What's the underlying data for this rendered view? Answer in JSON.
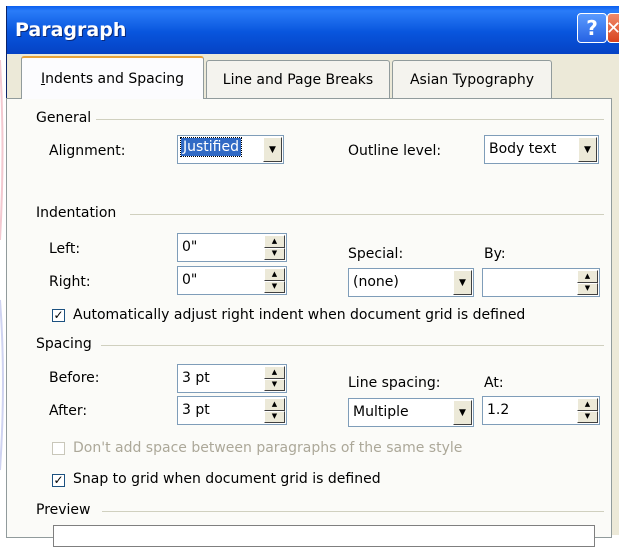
{
  "dialog": {
    "title": "Paragraph",
    "help_glyph": "?",
    "close_glyph": "✕"
  },
  "tabs": [
    {
      "label": "Indents and Spacing",
      "active": true
    },
    {
      "label": "Line and Page Breaks",
      "active": false
    },
    {
      "label": "Asian Typography",
      "active": false
    }
  ],
  "general": {
    "label": "General",
    "alignment_label": "Alignment:",
    "alignment_value": "Justified",
    "outline_label": "Outline level:",
    "outline_value": "Body text"
  },
  "indentation": {
    "label": "Indentation",
    "left_label": "Left:",
    "left_value": "0\"",
    "right_label": "Right:",
    "right_value": "0\"",
    "special_label": "Special:",
    "special_value": "(none)",
    "by_label": "By:",
    "by_value": "",
    "auto_adjust_label": "Automatically adjust right indent when document grid is defined",
    "auto_adjust_checked": true
  },
  "spacing": {
    "label": "Spacing",
    "before_label": "Before:",
    "before_value": "3 pt",
    "after_label": "After:",
    "after_value": "3 pt",
    "line_spacing_label": "Line spacing:",
    "line_spacing_value": "Multiple",
    "at_label": "At:",
    "at_value": "1.2",
    "dont_add_label": "Don't add space between paragraphs of the same style",
    "dont_add_checked": false,
    "snap_label": "Snap to grid when document grid is defined",
    "snap_checked": true
  },
  "preview": {
    "label": "Preview"
  },
  "colors": {
    "title_bar": "#0855dd",
    "close_button": "#d8421e",
    "active_tab_accent": "#e8a33a",
    "selection": "#316ac5"
  },
  "icons": {
    "dropdown": "dropdown-arrow-icon",
    "spinner_up": "spin-up-icon",
    "spinner_down": "spin-down-icon",
    "check": "checkmark-icon"
  }
}
